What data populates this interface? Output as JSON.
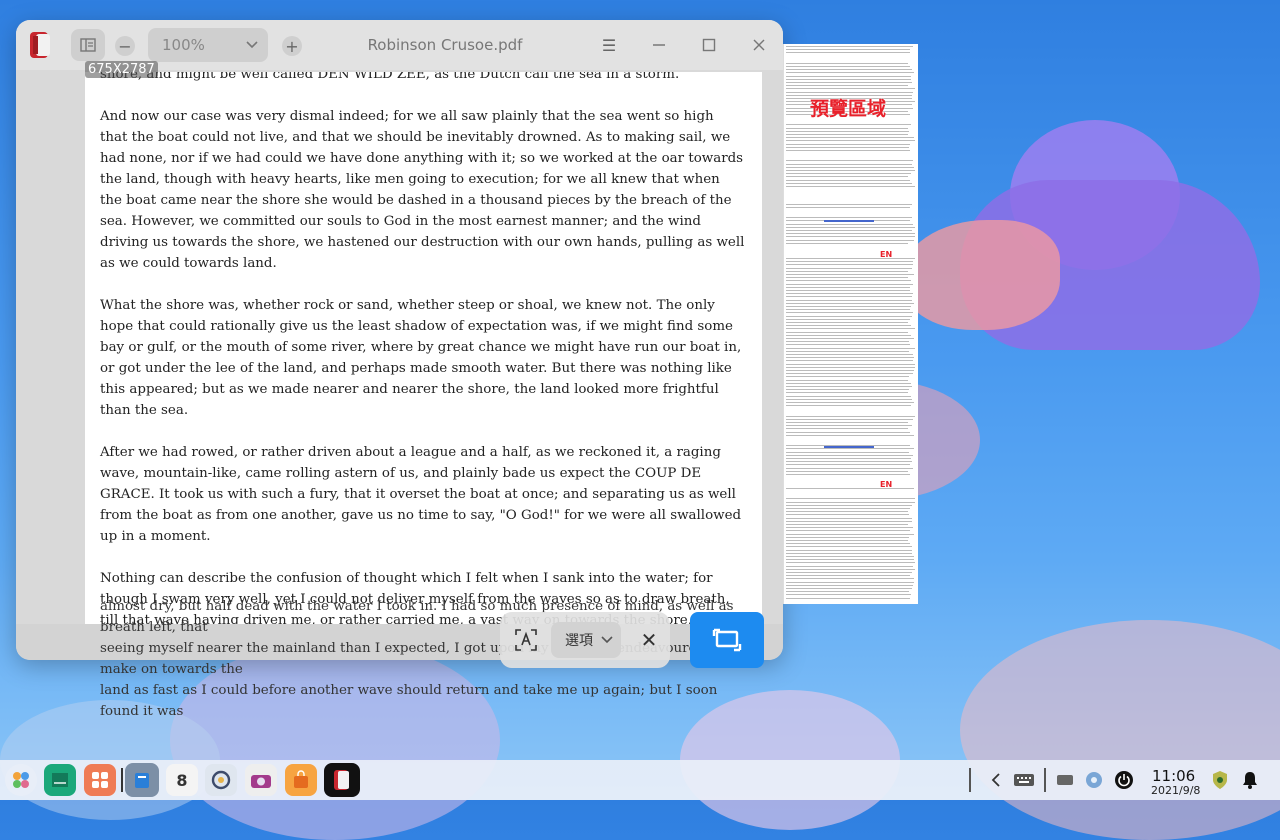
{
  "window": {
    "title": "Robinson Crusoe.pdf",
    "zoom": "100%",
    "zoom_out_label": "−",
    "zoom_in_label": "+",
    "menu_label": "☰"
  },
  "selection_size_label": "675X2787",
  "page_paragraphs": [
    "shore, and might be well called DEN WILD ZEE, as the Dutch call the sea in a storm.",
    "And now our case was very dismal indeed; for we all saw plainly that the sea went so high that the boat could not live, and that we should be inevitably drowned. As to making sail, we had none, nor if we had could we have done anything with it; so we worked at the oar towards the land, though with heavy hearts, like men going to execution; for we all knew that when the boat came near the shore she would be dashed in a thousand pieces by the breach of the sea. However, we committed our souls to God in the most earnest manner; and the wind driving us towards the shore, we hastened our destruction with our own hands, pulling as well as we could towards land.",
    "What the shore was, whether rock or sand, whether steep or shoal, we knew not. The only hope that could rationally give us the least shadow of expectation was, if we might find some bay or gulf, or the mouth of some river, where by great chance we might have run our boat in, or got under the lee of the land, and perhaps made smooth water. But there was nothing like this appeared; but as we made nearer and nearer the shore, the land looked more frightful than the sea.",
    "After we had rowed, or rather driven about a league and a half, as we reckoned it, a raging wave, mountain-like, came rolling astern of us, and plainly bade us expect the COUP DE GRACE. It took us with such a fury, that it overset the boat at once; and separating us as well from the boat as from one another, gave us no time to say, \"O God!\" for we were all swallowed up in a moment.",
    "Nothing can describe the confusion of thought which I felt when I sank into the water; for though I swam very well, yet I could not deliver myself from the waves so as to draw breath, till that wave having driven me, or rather carried me, a vast way on towards the shore, and having spent itself, went back, and left me upon the land"
  ],
  "overflow_lines": [
    "almost dry, but half dead with the water I took in. I had so much presence of mind, as well as breath left, that",
    "seeing myself nearer the mainland than I expected, I got upon my feet, and endeavoured to make on towards the",
    "land as fast as I could before another wave should return and take me up again; but I soon found it was"
  ],
  "preview": {
    "label": "預覽區域",
    "logo_text": "EN"
  },
  "screenshot_toolbar": {
    "options_label": "選項",
    "cancel_label": "✕"
  },
  "taskbar": {
    "calendar_day": "8",
    "time": "11:06",
    "date": "2021/9/8"
  },
  "colors": {
    "accent": "#1d8bf0",
    "preview_label": "#e8202a"
  }
}
